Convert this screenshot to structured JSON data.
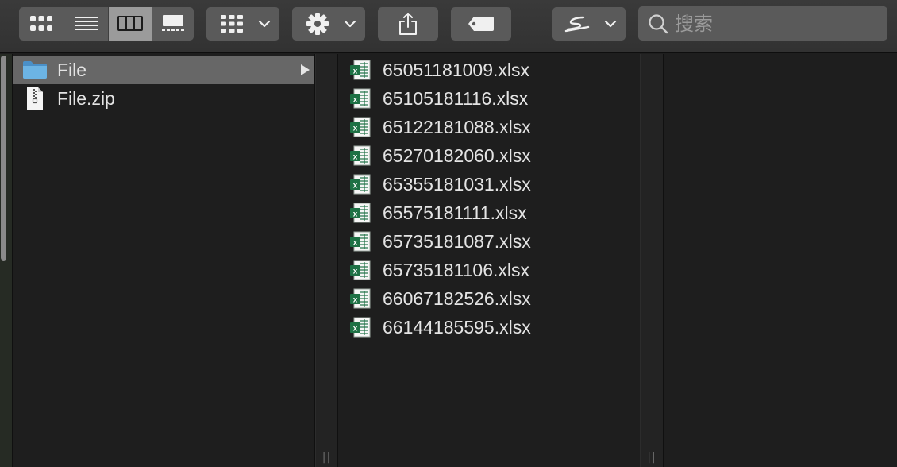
{
  "toolbar": {
    "view_buttons": [
      "icon-view",
      "list-view",
      "column-view",
      "gallery-view"
    ],
    "selected_view": "column-view",
    "search": {
      "placeholder": "搜索",
      "value": ""
    }
  },
  "column1": {
    "items": [
      {
        "name": "File",
        "type": "folder",
        "selected": true,
        "has_children": true
      },
      {
        "name": "File.zip",
        "type": "zip",
        "selected": false,
        "has_children": false
      }
    ]
  },
  "column2": {
    "items": [
      {
        "name": "65051181009.xlsx",
        "type": "xlsx"
      },
      {
        "name": "65105181116.xlsx",
        "type": "xlsx"
      },
      {
        "name": "65122181088.xlsx",
        "type": "xlsx"
      },
      {
        "name": "65270182060.xlsx",
        "type": "xlsx"
      },
      {
        "name": "65355181031.xlsx",
        "type": "xlsx"
      },
      {
        "name": "65575181111.xlsx",
        "type": "xlsx"
      },
      {
        "name": "65735181087.xlsx",
        "type": "xlsx"
      },
      {
        "name": "65735181106.xlsx",
        "type": "xlsx"
      },
      {
        "name": "66067182526.xlsx",
        "type": "xlsx"
      },
      {
        "name": "66144185595.xlsx",
        "type": "xlsx"
      }
    ]
  },
  "colors": {
    "toolbar_bg": "#353535",
    "button_bg": "#5a5a5a",
    "selected_segment": "#9b9b9b",
    "selected_row": "#676767",
    "folder_blue": "#5fa8dc",
    "excel_green": "#1e7145",
    "text": "#e4e4e4"
  }
}
